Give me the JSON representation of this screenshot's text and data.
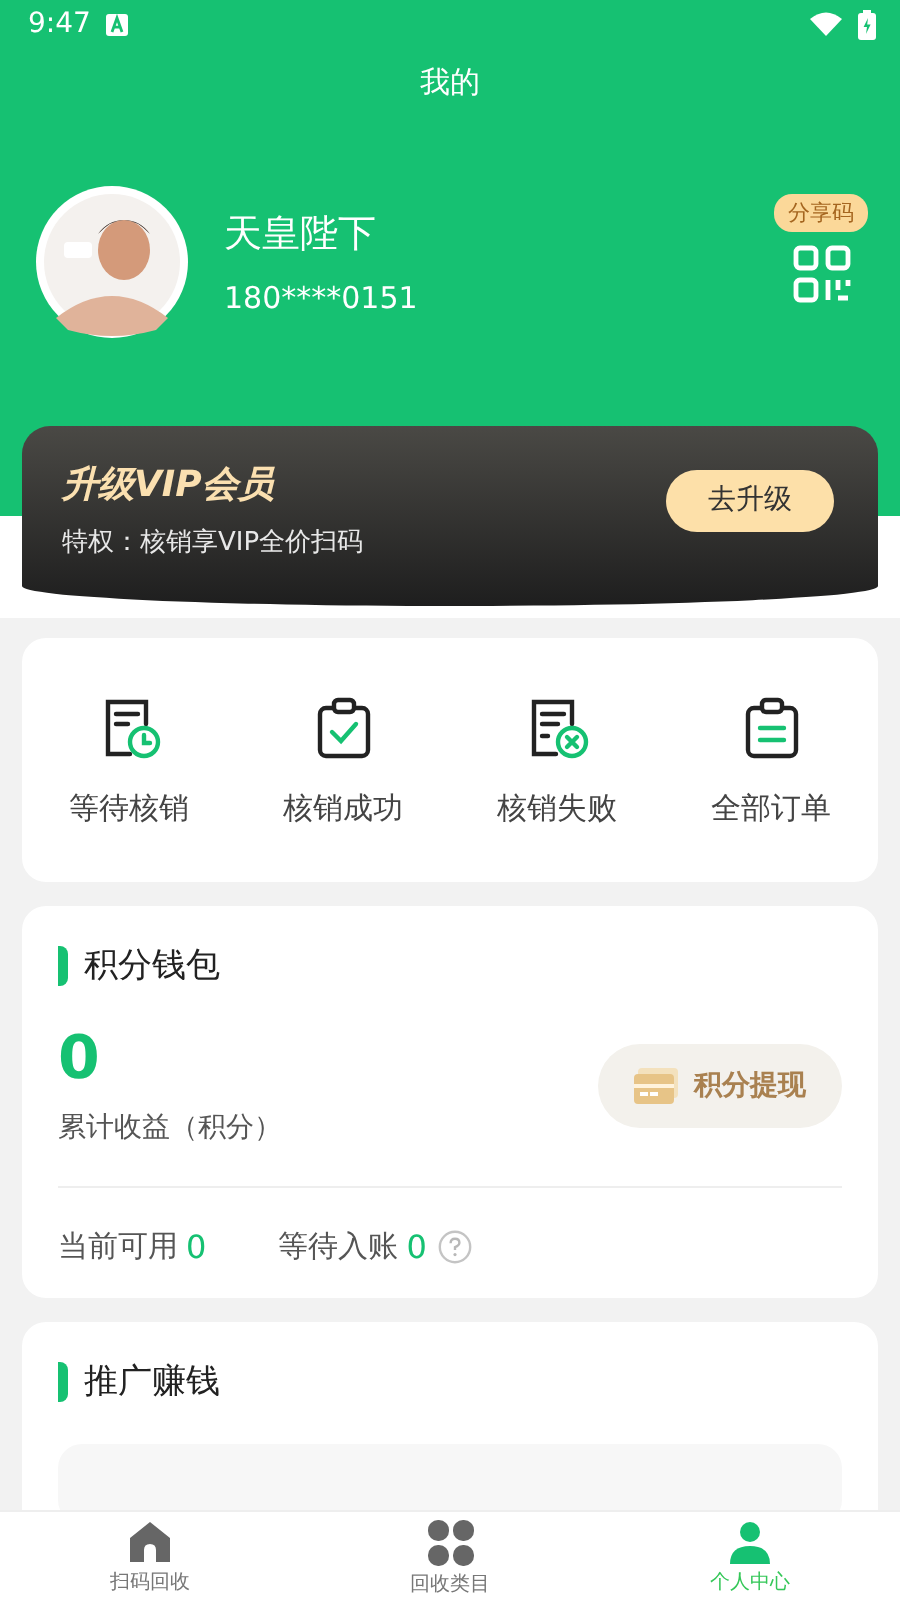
{
  "status_bar": {
    "time": "9:47"
  },
  "title": "我的",
  "profile": {
    "name": "天皇陛下",
    "phone": "180****0151",
    "share_badge": "分享码"
  },
  "vip": {
    "title": "升级VIP会员",
    "subtitle": "特权：核销享VIP全价扫码",
    "button": "去升级"
  },
  "orders": [
    {
      "label": "等待核销",
      "kind": "pending"
    },
    {
      "label": "核销成功",
      "kind": "success"
    },
    {
      "label": "核销失败",
      "kind": "failed"
    },
    {
      "label": "全部订单",
      "kind": "all"
    }
  ],
  "wallet": {
    "title": "积分钱包",
    "total": "0",
    "total_label": "累计收益（积分）",
    "withdraw_button": "积分提现",
    "available_label": "当前可用",
    "available_value": "0",
    "pending_label": "等待入账",
    "pending_value": "0"
  },
  "promo": {
    "title": "推广赚钱"
  },
  "tabs": [
    {
      "label": "扫码回收",
      "kind": "home",
      "selected": false
    },
    {
      "label": "回收类目",
      "kind": "grid",
      "selected": false
    },
    {
      "label": "个人中心",
      "kind": "person",
      "selected": true
    }
  ]
}
